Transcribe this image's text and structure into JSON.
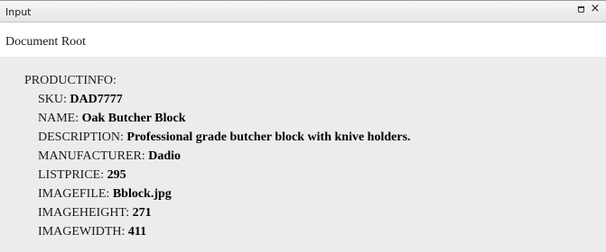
{
  "panel": {
    "title": "Input",
    "restore_icon": "restore-window-icon",
    "close_icon": "close-icon",
    "close_glyph": "×"
  },
  "tree": {
    "root_label": "Document Root",
    "node_label": "PRODUCTINFO:",
    "fields": [
      {
        "key": "SKU:",
        "value": "DAD7777"
      },
      {
        "key": "NAME:",
        "value": "Oak Butcher Block"
      },
      {
        "key": "DESCRIPTION:",
        "value": "Professional grade butcher block with knive holders."
      },
      {
        "key": "MANUFACTURER:",
        "value": "Dadio"
      },
      {
        "key": "LISTPRICE:",
        "value": "295"
      },
      {
        "key": "IMAGEFILE:",
        "value": "Bblock.jpg"
      },
      {
        "key": "IMAGEHEIGHT:",
        "value": "271"
      },
      {
        "key": "IMAGEWIDTH:",
        "value": "411"
      }
    ]
  }
}
